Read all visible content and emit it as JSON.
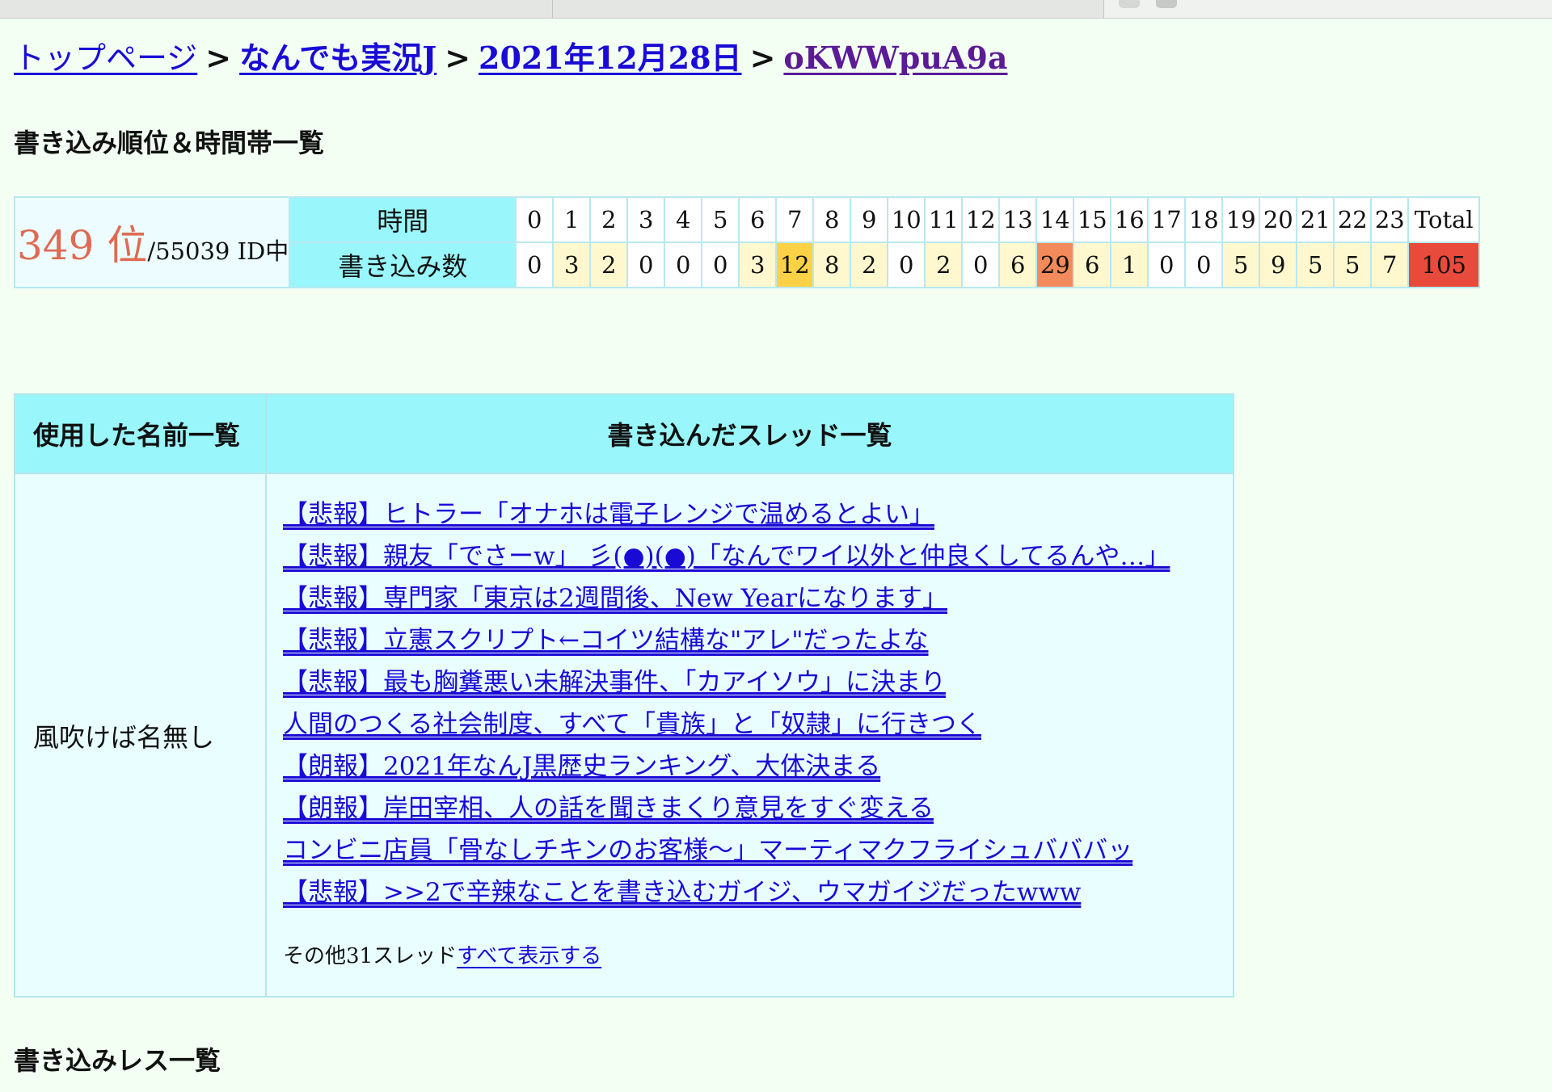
{
  "breadcrumb": [
    {
      "label": "トップページ"
    },
    {
      "label": "なんでも実況J"
    },
    {
      "label": "2021年12月28日"
    },
    {
      "label": "oKWWpuA9a"
    }
  ],
  "separator": ">",
  "section_rank_title": "書き込み順位＆時間帯一覧",
  "rank": {
    "position": "349 位",
    "suffix": "/55039 ID中"
  },
  "hour_table": {
    "row_header_time": "時間",
    "row_header_count": "書き込み数",
    "hours": [
      "0",
      "1",
      "2",
      "3",
      "4",
      "5",
      "6",
      "7",
      "8",
      "9",
      "10",
      "11",
      "12",
      "13",
      "14",
      "15",
      "16",
      "17",
      "18",
      "19",
      "20",
      "21",
      "22",
      "23"
    ],
    "counts": [
      "0",
      "3",
      "2",
      "0",
      "0",
      "0",
      "3",
      "12",
      "8",
      "2",
      "0",
      "2",
      "0",
      "6",
      "29",
      "6",
      "1",
      "0",
      "0",
      "5",
      "9",
      "5",
      "5",
      "7"
    ],
    "total_label": "Total",
    "total_value": "105",
    "colors": {
      "zero": "#ffffff",
      "low": "#fff8cf",
      "mid": "#fbd245",
      "high": "#f28a5c",
      "total": "#e84a3c"
    }
  },
  "threads": {
    "names_header": "使用した名前一覧",
    "threads_header": "書き込んだスレッド一覧",
    "name": "風吹けば名無し",
    "items": [
      "【悲報】ヒトラー「オナホは電子レンジで温めるとよい」",
      "【悲報】親友「でさーw」 彡(●)(●)「なんでワイ以外と仲良くしてるんや…」",
      "【悲報】専門家「東京は2週間後、New Yearになります」",
      "【悲報】立憲スクリプト←コイツ結構な\"アレ\"だったよな",
      "【悲報】最も胸糞悪い未解決事件、「カアイソウ」に決まり",
      "人間のつくる社会制度、すべて「貴族」と「奴隷」に行きつく",
      "【朗報】2021年なんJ黒歴史ランキング、大体決まる",
      "【朗報】岸田宰相、人の話を聞きまくり意見をすぐ変える",
      "コンビニ店員「骨なしチキンのお客様〜」マーティマクフライシュバババッ",
      "【悲報】>>2で辛辣なことを書き込むガイジ、ウマガイジだったwww"
    ],
    "more_prefix": "その他31スレッド",
    "more_link": "すべて表示する"
  },
  "section_posts_title": "書き込みレス一覧"
}
